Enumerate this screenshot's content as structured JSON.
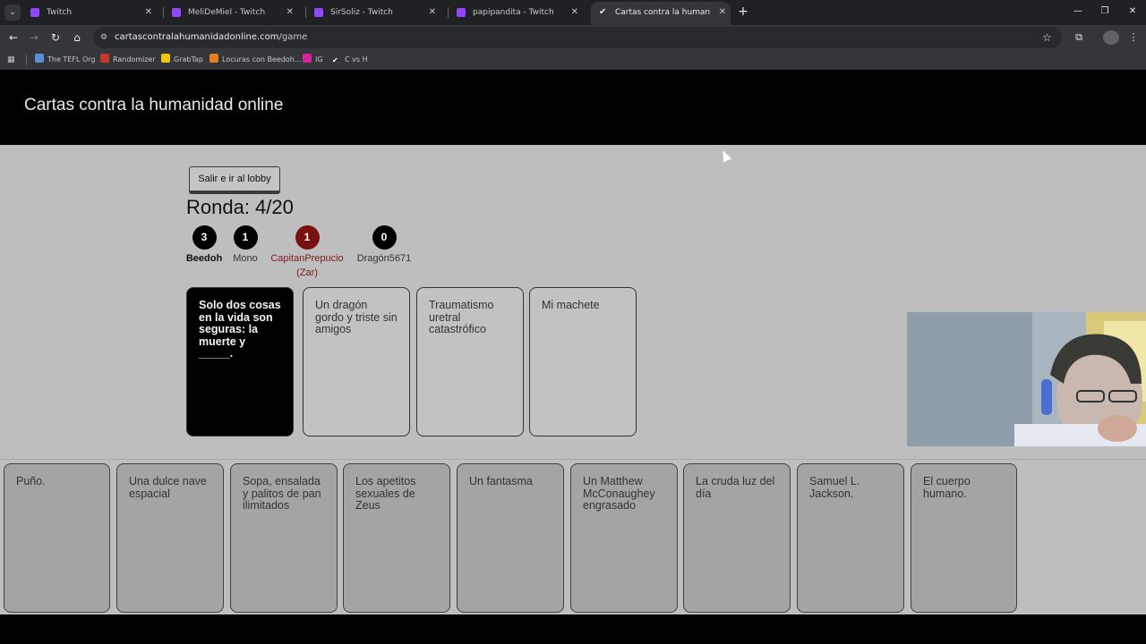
{
  "browser": {
    "tabs": [
      {
        "title": "Twitch",
        "icon": "twitch-icon"
      },
      {
        "title": "MeliDeMiel - Twitch",
        "icon": "twitch-icon"
      },
      {
        "title": "SirSoliz - Twitch",
        "icon": "twitch-icon"
      },
      {
        "title": "papipandita - Twitch",
        "icon": "twitch-icon"
      },
      {
        "title": "Cartas contra la humanidad onl",
        "icon": "check-icon",
        "active": true
      }
    ],
    "url_host": "cartascontralahumanidadonline.com",
    "url_path": "/game",
    "bookmarks": [
      {
        "label": "The TEFL Org",
        "color": "#5a8fd8"
      },
      {
        "label": "Randomizer",
        "color": "#c0392b"
      },
      {
        "label": "GrabTap",
        "color": "#f1c40f"
      },
      {
        "label": "Locuras con Beedoh...",
        "color": "#e67e22"
      },
      {
        "label": "IG",
        "color": "#d6249f"
      },
      {
        "label": "C vs H",
        "color": "#ffffff"
      }
    ]
  },
  "page": {
    "title": "Cartas contra la humanidad online",
    "lobby_button": "Salir e ir al lobby",
    "round": "Ronda: 4/20"
  },
  "players": [
    {
      "score": "3",
      "name": "Beedoh",
      "bold": true
    },
    {
      "score": "1",
      "name": "Mono"
    },
    {
      "score": "1",
      "name": "CapitanPrepucio",
      "extra": "(Zar)",
      "czar": true
    },
    {
      "score": "0",
      "name": "Dragón5671"
    }
  ],
  "black_card": "Solo dos cosas en la vida son seguras: la muerte y _____.",
  "played_cards": [
    "Un dragón gordo y triste sin amigos",
    "Traumatismo uretral catastrófico",
    "Mi machete"
  ],
  "hand_cards": [
    "Puño.",
    "Una dulce nave espacial",
    "Sopa, ensalada y palitos de pan ilimitados",
    "Los apetitos sexuales de Zeus",
    "Un fantasma",
    "Un Matthew McConaughey engrasado",
    "La cruda luz del día",
    "Samuel L. Jackson.",
    "El cuerpo humano."
  ]
}
